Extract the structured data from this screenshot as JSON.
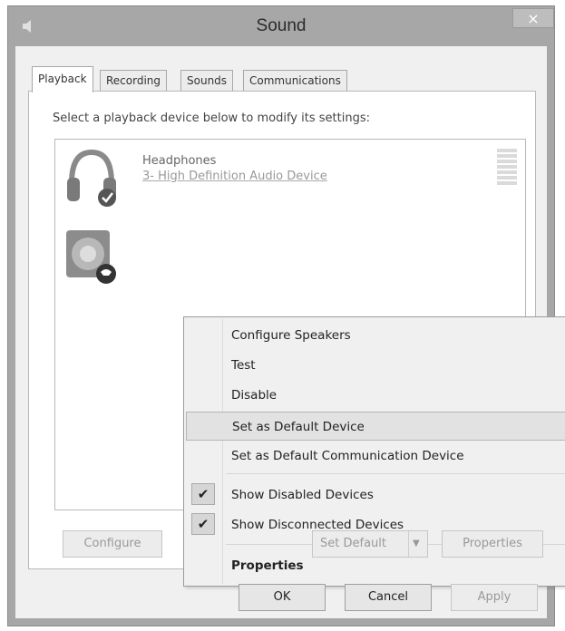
{
  "window": {
    "title": "Sound",
    "close_glyph": "×"
  },
  "tabs": [
    {
      "label": "Playback",
      "active": true
    },
    {
      "label": "Recording",
      "active": false
    },
    {
      "label": "Sounds",
      "active": false
    },
    {
      "label": "Communications",
      "active": false
    }
  ],
  "instruction": "Select a playback device below to modify its settings:",
  "devices": [
    {
      "name": "Headphones",
      "description": "3- High Definition Audio Device",
      "icon": "headphones-icon",
      "status": "default-checkmark"
    },
    {
      "name": "",
      "description": "",
      "icon": "speaker-icon",
      "status": "communication-phone"
    }
  ],
  "context_menu": {
    "items": [
      {
        "label": "Configure Speakers",
        "checked": false
      },
      {
        "label": "Test",
        "checked": false
      },
      {
        "label": "Disable",
        "checked": false
      },
      {
        "label": "Set as Default Device",
        "checked": false,
        "highlighted": true
      },
      {
        "label": "Set as Default Communication Device",
        "checked": false
      },
      {
        "label": "Show Disabled Devices",
        "checked": true
      },
      {
        "label": "Show Disconnected Devices",
        "checked": true
      },
      {
        "label": "Properties",
        "checked": false,
        "bold": true
      }
    ],
    "check_glyph": "✔"
  },
  "panel_buttons": {
    "configure": "Configure",
    "set_default": "Set Default",
    "set_default_arrow": "▼",
    "properties": "Properties"
  },
  "dialog_buttons": {
    "ok": "OK",
    "cancel": "Cancel",
    "apply": "Apply"
  },
  "colors": {
    "titlebar": "#a7a7a7",
    "client": "#f0f0f0",
    "highlight": "#e2e2e2"
  }
}
